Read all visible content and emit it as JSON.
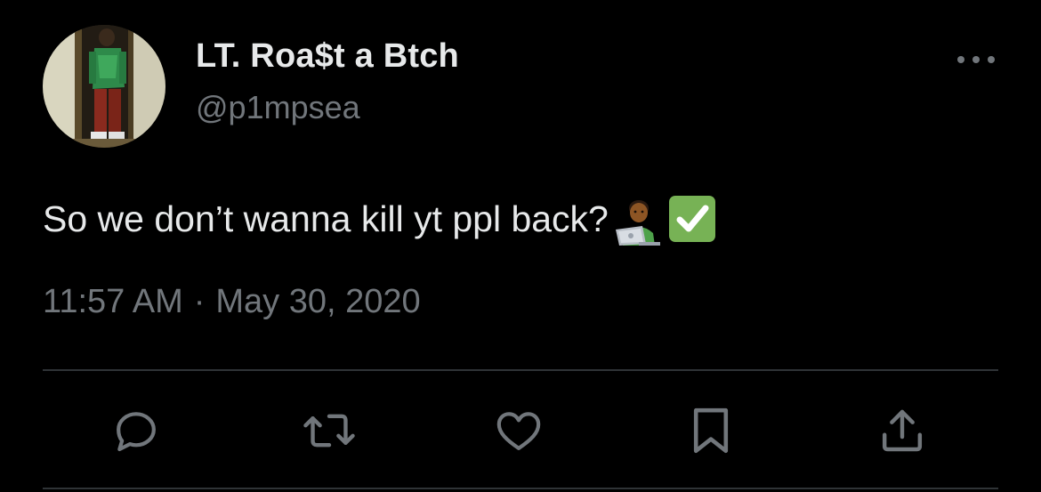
{
  "tweet": {
    "author": {
      "display_name": "LT. Roa$t a Btch",
      "handle": "@p1mpsea",
      "avatar_icon": "profile-photo-avatar"
    },
    "more_icon": "more-dots-icon",
    "text": "So we don’t wanna kill yt ppl back?",
    "emojis": [
      "technologist-emoji",
      "check-mark-button-emoji"
    ],
    "time": "11:57 AM",
    "separator": "·",
    "date": "May 30, 2020",
    "actions": [
      {
        "name": "reply",
        "icon": "reply-icon"
      },
      {
        "name": "retweet",
        "icon": "retweet-icon"
      },
      {
        "name": "like",
        "icon": "heart-icon"
      },
      {
        "name": "bookmark",
        "icon": "bookmark-icon"
      },
      {
        "name": "share",
        "icon": "share-icon"
      }
    ]
  },
  "colors": {
    "background": "#000000",
    "primary_text": "#e7e9ea",
    "secondary_text": "#71767b",
    "divider": "#2f3336",
    "check_green": "#77b255"
  }
}
